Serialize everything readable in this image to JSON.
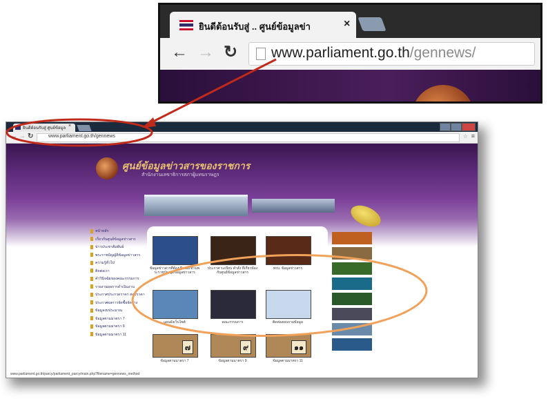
{
  "zoom": {
    "tab_title": "ยินดีต้อนรับสู่ .. ศูนย์ข้อมูลข่า",
    "tab_close": "×",
    "url_domain": "www.parliament.go.th",
    "url_path": "/gennews/",
    "icons": [
      "back-icon",
      "forward-icon",
      "reload-icon",
      "page-icon"
    ]
  },
  "browser": {
    "tab_title": "ยินดีต้อนรับสู่ ศูนย์ข้อมูล",
    "tab_close": "×",
    "url": "www.parliament.go.th/gennews",
    "page": {
      "site_title": "ศูนย์ข้อมูลข่าวสารของราชการ",
      "site_subtitle": "สำนักงานเลขาธิการสภาผู้แทนราษฎร",
      "nav": [
        "หน้าหลัก",
        "เกี่ยวกับศูนย์ข้อมูลข่าวสาร",
        "ข่าวประชาสัมพันธ์",
        "พระราชบัญญัติข้อมูลข่าวสาร",
        "ความรู้ทั่วไป",
        "ติดต่อเรา",
        "คำวินิจฉัยของคณะกรรมการ",
        "รายงานผลการดำเนินงาน",
        "ประกาศประกวดราคา สอบราคา",
        "ประกาศผลการจัดซื้อจัดจ้าง",
        "ข้อมูลงบประมาณ",
        "ข้อมูลตามมาตรา 7",
        "ข้อมูลตามมาตรา 9",
        "ข้อมูลตามมาตรา 11"
      ],
      "tiles": [
        {
          "caption": "ข้อมูลข่าวสารที่ต้องเปิดเผย ตามพระราชบัญญัติข้อมูลข่าวสาร",
          "color": "#2a4f8a"
        },
        {
          "caption": "ประกาศ ระเบียบ คำสั่ง ที่เกี่ยวข้องกับศูนย์ข้อมูลข่าวสาร",
          "color": "#3a2418"
        },
        {
          "caption": "พรบ. ข้อมูลข่าวสาร",
          "color": "#5a2a18"
        },
        {
          "caption": "แผนผังเว็บไซต์",
          "color": "#5a86b8"
        },
        {
          "caption": "คณะกรรมการ",
          "color": "#2a2a3a"
        },
        {
          "caption": "ติดต่อสอบถามข้อมูล",
          "color": "#c8d8ec"
        },
        {
          "caption": "ข้อมูลตามมาตรา 7",
          "badge": "๗",
          "color": "#b08858"
        },
        {
          "caption": "ข้อมูลตามมาตรา 9",
          "badge": "๙",
          "color": "#b08858"
        },
        {
          "caption": "ข้อมูลตามมาตรา 11",
          "badge": "๑๑",
          "color": "#b08858"
        }
      ],
      "banners": [
        "#c06020",
        "#8a6a40",
        "#386a2a",
        "#1a6a8a",
        "#2a5a2a",
        "#4a4a5a",
        "#6a8aaa",
        "#2a5a8a"
      ],
      "status_text": "www.parliament.go.th/parcy/parliament_parcy/main.php?filename=gennews_method"
    }
  },
  "colors": {
    "callout_arrow": "#c02a1a",
    "highlight_oval": "#f0a25a",
    "site_purple": "#5c2a78",
    "nav_bullet": "#d9a21b"
  }
}
